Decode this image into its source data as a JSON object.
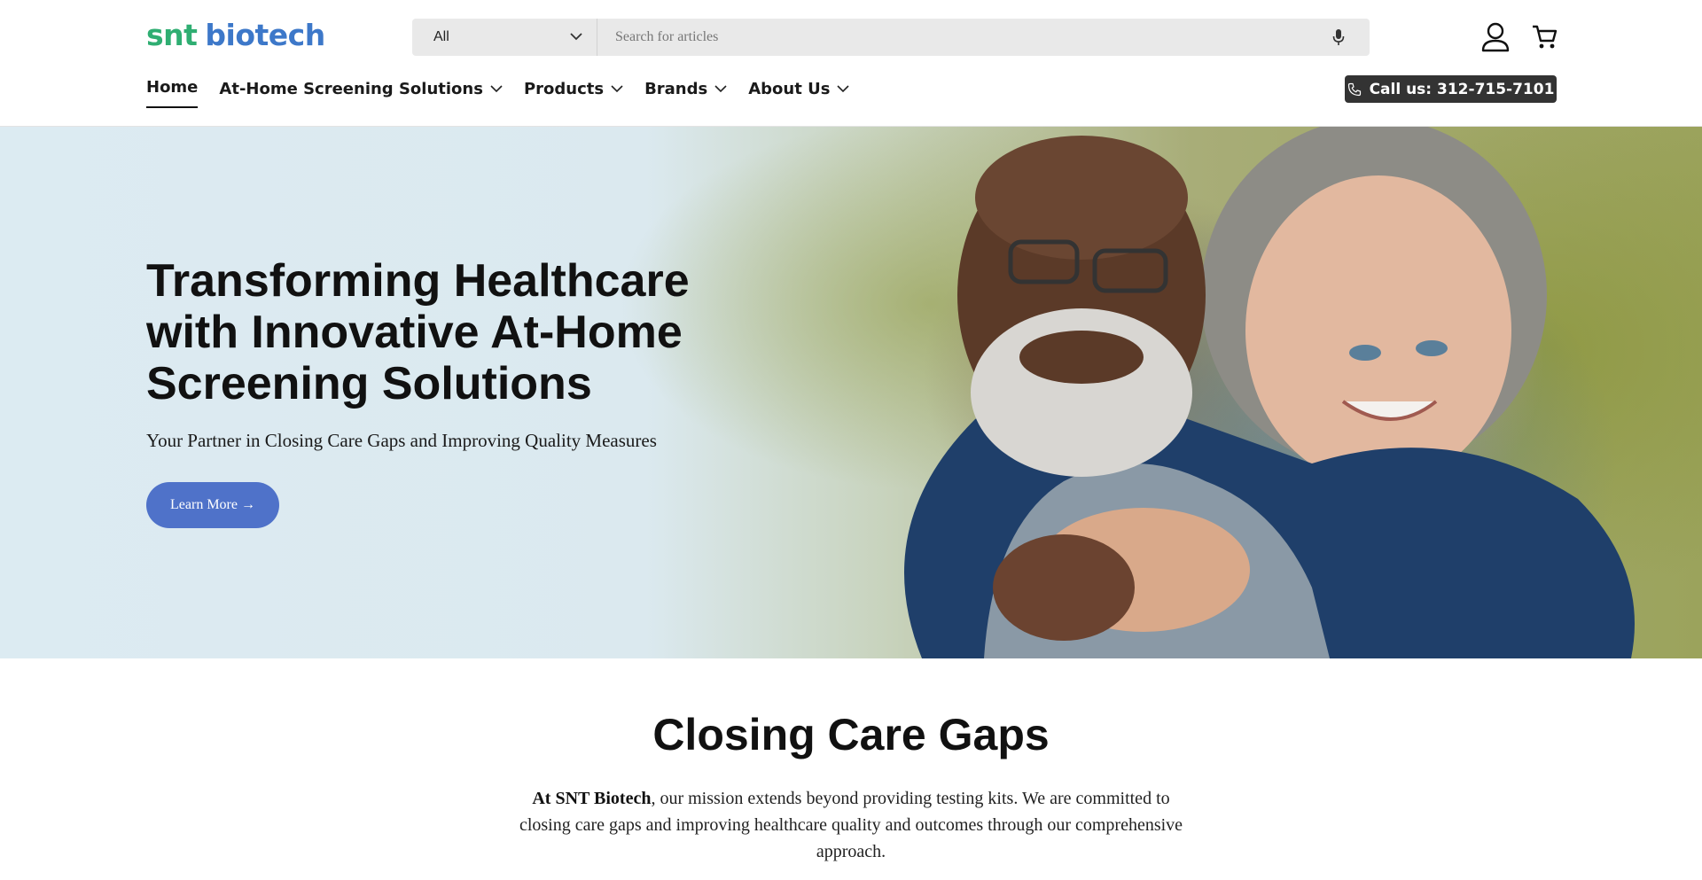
{
  "header": {
    "logo": {
      "part1": "snt",
      "part2": "biotech"
    },
    "search": {
      "category": "All",
      "placeholder": "Search for articles"
    },
    "icons": {
      "mic": "microphone-icon",
      "account": "account-icon",
      "cart": "cart-icon"
    },
    "nav": [
      {
        "label": "Home",
        "active": true
      },
      {
        "label": "At-Home Screening Solutions",
        "dropdown": true
      },
      {
        "label": "Products",
        "dropdown": true
      },
      {
        "label": "Brands",
        "dropdown": true
      },
      {
        "label": "About Us",
        "dropdown": true
      }
    ],
    "call_label": "Call us: 312-715-7101"
  },
  "hero": {
    "title": "Transforming Healthcare with Innovative At-Home Screening Solutions",
    "subtitle": "Your Partner in Closing Care Gaps and Improving Quality Measures",
    "button_label": "Learn More →"
  },
  "section": {
    "title": "Closing Care Gaps",
    "text_bold": "At SNT Biotech",
    "text_rest": ", our mission extends beyond providing testing kits. We are committed to closing care gaps and improving healthcare quality and outcomes through our comprehensive approach."
  },
  "colors": {
    "logo_green": "#2fae72",
    "logo_blue": "#3d78c9",
    "button_blue": "#4f72c9",
    "call_button": "#333333"
  }
}
